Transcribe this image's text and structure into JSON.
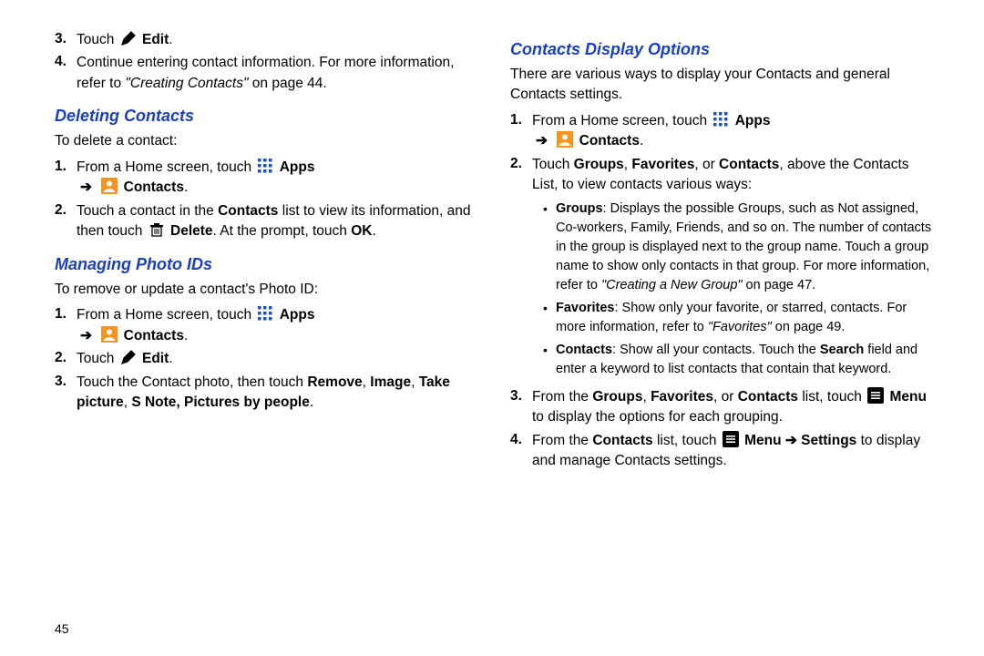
{
  "left": {
    "step3_pre": "Touch",
    "step3_label": "Edit",
    "step4_a": "Continue entering contact information. For more information, refer to ",
    "step4_ref": "\"Creating Contacts\"",
    "step4_b": " on page 44.",
    "h_delete": "Deleting Contacts",
    "delete_intro": "To delete a contact:",
    "del1_a": "From a Home screen, touch ",
    "del1_apps": "Apps",
    "del1_contacts": "Contacts",
    "del2_a": "Touch a contact in the ",
    "del2_b": "Contacts",
    "del2_c": " list to view its information, and then touch ",
    "del2_d": "Delete",
    "del2_e": ". At the prompt, touch ",
    "del2_f": "OK",
    "h_photo": "Managing Photo IDs",
    "photo_intro": "To remove or update a contact's Photo ID:",
    "ph1_a": "From a Home screen, touch ",
    "ph1_apps": "Apps",
    "ph1_contacts": "Contacts",
    "ph2_pre": "Touch",
    "ph2_label": "Edit",
    "ph3_a": "Touch the Contact photo, then touch ",
    "ph3_b": "Remove",
    "ph3_c": "Image",
    "ph3_d": "Take picture",
    "ph3_e": "S Note, Pictures by people"
  },
  "right": {
    "h_disp": "Contacts Display Options",
    "disp_intro": "There are various ways to display your Contacts and general Contacts settings.",
    "d1_a": "From a Home screen, touch ",
    "d1_apps": "Apps",
    "d1_contacts": "Contacts",
    "d2_a": "Touch ",
    "d2_b": "Groups",
    "d2_c": "Favorites",
    "d2_d": ", or ",
    "d2_e": "Contacts",
    "d2_f": ", above the Contacts List, to view contacts various ways:",
    "b1_head": "Groups",
    "b1_body_a": ": Displays the possible Groups, such as Not assigned, Co-workers, Family, Friends, and so on. The number of contacts in the group is displayed next to the group name. Touch a group name to show only contacts in that group. For more information, refer to ",
    "b1_ref": "\"Creating a New Group\"",
    "b1_body_b": " on page 47.",
    "b2_head": "Favorites",
    "b2_body_a": ": Show only your favorite, or starred, contacts. For more information, refer to ",
    "b2_ref": "\"Favorites\"",
    "b2_body_b": " on page 49.",
    "b3_head": "Contacts",
    "b3_body_a": ": Show all your contacts. Touch the ",
    "b3_search": "Search",
    "b3_body_b": " field and enter a keyword to list contacts that contain that keyword.",
    "d3_a": "From the ",
    "d3_b": "Groups",
    "d3_c": "Favorites",
    "d3_d": ", or ",
    "d3_e": "Contacts",
    "d3_f": " list, touch ",
    "d3_menu": "Menu",
    "d3_g": " to display the options for each grouping.",
    "d4_a": "From the ",
    "d4_b": "Contacts",
    "d4_c": " list, touch ",
    "d4_menu": "Menu",
    "d4_arrow": " ➔ ",
    "d4_settings": "Settings",
    "d4_d": " to display and manage Contacts settings."
  },
  "nums": {
    "3": "3.",
    "4": "4.",
    "1": "1.",
    "2": "2."
  },
  "page_number": "45",
  "arrow": "➔",
  "dot": "•",
  "period": ".",
  "comma": ", "
}
